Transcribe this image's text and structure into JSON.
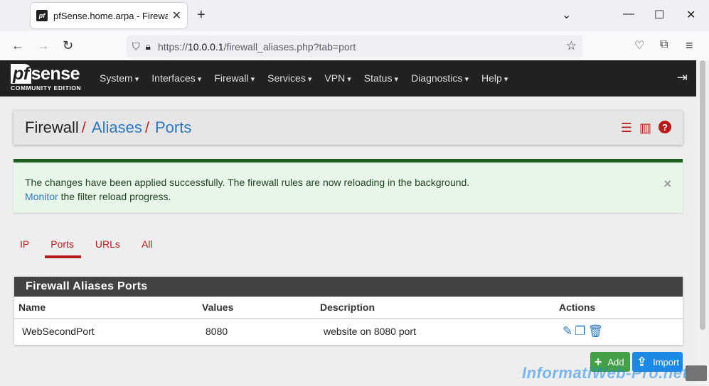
{
  "browser": {
    "tab_title": "pfSense.home.arpa - Firewall: A",
    "favicon_text": "pf",
    "url_scheme_prefix": "https://",
    "url_host": "10.0.0.1",
    "url_path": "/firewall_aliases.php?tab=port"
  },
  "pfsense": {
    "logo_pf": "pf",
    "logo_sense": "sense",
    "edition": "COMMUNITY EDITION",
    "menu": [
      "System",
      "Interfaces",
      "Firewall",
      "Services",
      "VPN",
      "Status",
      "Diagnostics",
      "Help"
    ]
  },
  "breadcrumb": {
    "home": "Firewall",
    "level1": "Aliases",
    "level2": "Ports",
    "separator": "/"
  },
  "alert": {
    "message": "The changes have been applied successfully. The firewall rules are now reloading in the background.",
    "link_text": "Monitor",
    "link_suffix": " the filter reload progress.",
    "close": "×"
  },
  "tabs": [
    {
      "label": "IP",
      "active": false
    },
    {
      "label": "Ports",
      "active": true
    },
    {
      "label": "URLs",
      "active": false
    },
    {
      "label": "All",
      "active": false
    }
  ],
  "panel": {
    "title": "Firewall Aliases Ports",
    "columns": [
      "Name",
      "Values",
      "Description",
      "Actions"
    ],
    "rows": [
      {
        "name": "WebSecondPort",
        "values": "8080",
        "description": "website on 8080 port"
      }
    ]
  },
  "buttons": {
    "add": "Add",
    "import": "Import"
  },
  "watermark": "InformatiWeb-Pro.net",
  "colors": {
    "accent_red": "#b71c1c",
    "link_blue": "#2a78c0",
    "header_dark": "#212121",
    "success_green": "#1b5e20"
  }
}
